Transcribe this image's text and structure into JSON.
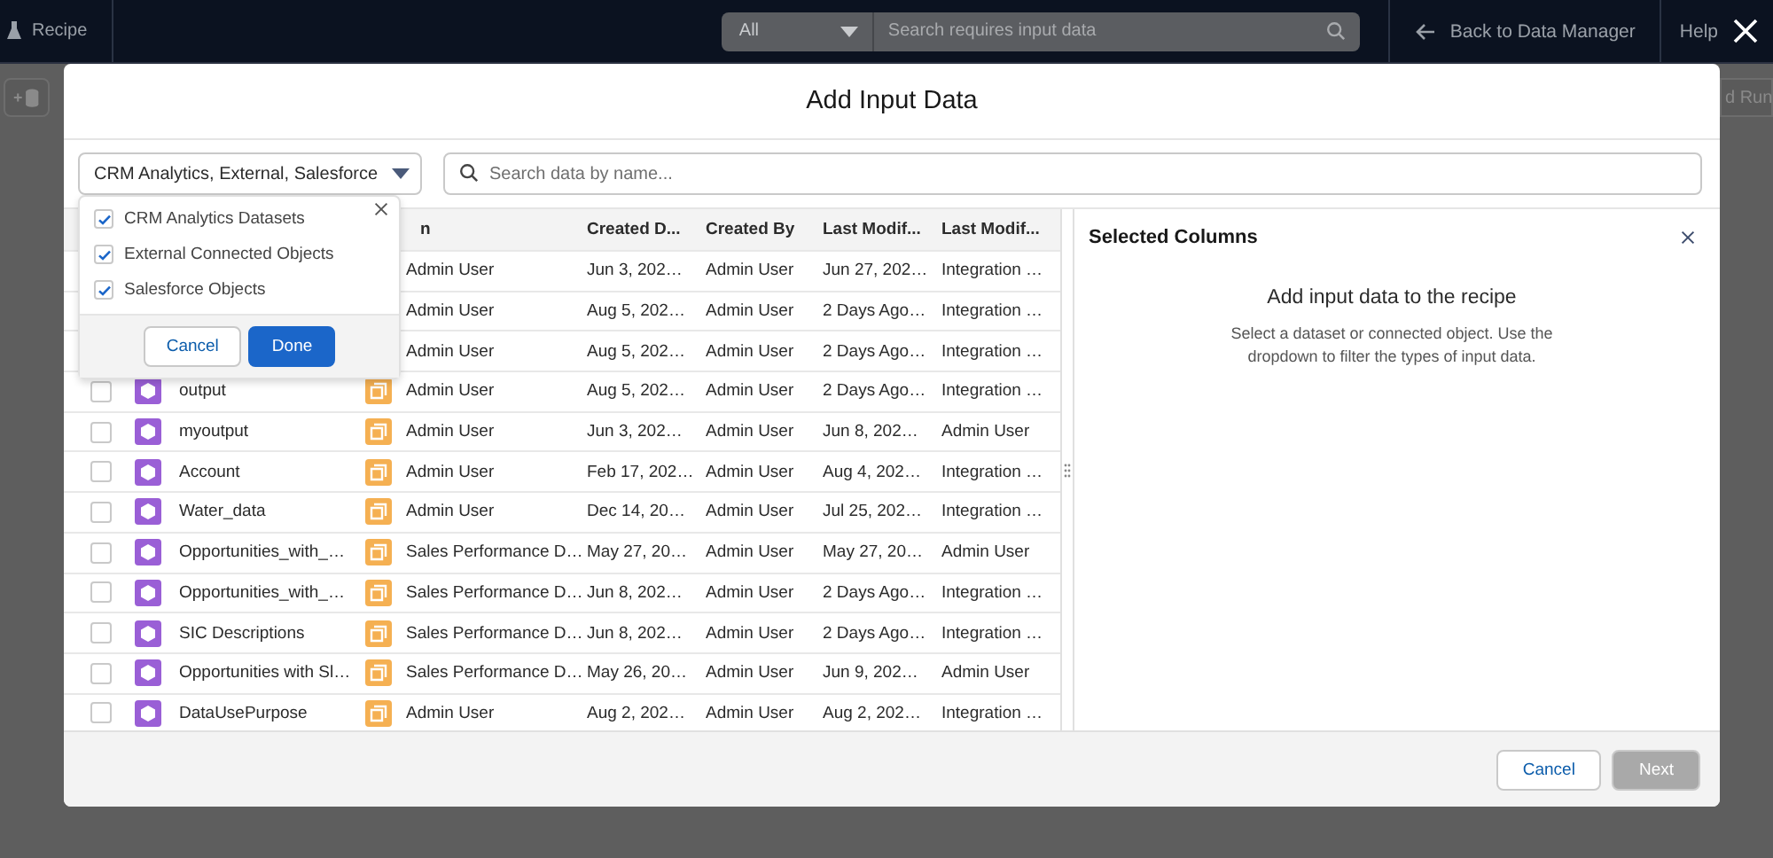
{
  "top_bar": {
    "app_name": "Recipe",
    "search_scope": "All",
    "search_placeholder": "Search requires input data",
    "back_link": "Back to Data Manager",
    "help": "Help"
  },
  "toolbar_right_button": "d Run",
  "dialog": {
    "title": "Add Input Data",
    "filter_dropdown": {
      "value": "CRM Analytics, External, Salesforce",
      "expanded": true,
      "options": [
        {
          "label": "CRM Analytics Datasets",
          "checked": true
        },
        {
          "label": "External Connected Objects",
          "checked": true
        },
        {
          "label": "Salesforce Objects",
          "checked": true
        }
      ],
      "buttons": [
        {
          "label": "Cancel",
          "kind": "neutral"
        },
        {
          "label": "Done",
          "kind": "brand"
        }
      ]
    },
    "search": {
      "placeholder": "Search data by name..."
    },
    "table": {
      "columns": [
        "n",
        "Created D...",
        "Created By",
        "Last Modif...",
        "Last Modif..."
      ],
      "rows": [
        {
          "cells": [
            "Admin User",
            "Jun 3, 202…",
            "Admin User",
            "Jun 27, 202…",
            "Integration …"
          ]
        },
        {
          "cells": [
            "Admin User",
            "Aug 5, 202…",
            "Admin User",
            "2 Days Ago…",
            "Integration …"
          ]
        },
        {
          "cells": [
            "Admin User",
            "Aug 5, 202…",
            "Admin User",
            "2 Days Ago…",
            "Integration …"
          ]
        },
        {
          "name": "output",
          "checked": false,
          "cells": [
            "Admin User",
            "Aug 5, 202…",
            "Admin User",
            "2 Days Ago…",
            "Integration …"
          ]
        },
        {
          "name": "myoutput",
          "checked": false,
          "cells": [
            "Admin User",
            "Jun 3, 202…",
            "Admin User",
            "Jun 8, 202…",
            "Admin User"
          ]
        },
        {
          "name": "Account",
          "checked": false,
          "cells": [
            "Admin User",
            "Feb 17, 202…",
            "Admin User",
            "Aug 4, 202…",
            "Integration …"
          ]
        },
        {
          "name": "Water_data",
          "checked": false,
          "cells": [
            "Admin User",
            "Dec 14, 20…",
            "Admin User",
            "Jul 25, 202…",
            "Integration …"
          ]
        },
        {
          "name": "Opportunities_with_…",
          "checked": false,
          "cells": [
            "Sales Performance D…",
            "May 27, 20…",
            "Admin User",
            "May 27, 20…",
            "Admin User"
          ]
        },
        {
          "name": "Opportunities_with_…",
          "checked": false,
          "cells": [
            "Sales Performance D…",
            "Jun 8, 202…",
            "Admin User",
            "2 Days Ago…",
            "Integration …"
          ]
        },
        {
          "name": "SIC Descriptions",
          "checked": false,
          "cells": [
            "Sales Performance D…",
            "Jun 8, 202…",
            "Admin User",
            "2 Days Ago…",
            "Integration …"
          ]
        },
        {
          "name": "Opportunities with Sl…",
          "checked": false,
          "cells": [
            "Sales Performance D…",
            "May 26, 20…",
            "Admin User",
            "Jun 9, 202…",
            "Admin User"
          ]
        },
        {
          "name": "DataUsePurpose",
          "checked": false,
          "cells": [
            "Admin User",
            "Aug 2, 202…",
            "Admin User",
            "Aug 2, 202…",
            "Integration …"
          ]
        }
      ]
    },
    "selected_columns": {
      "title": "Selected Columns",
      "empty_title": "Add input data to the recipe",
      "empty_text": "Select a dataset or connected object. Use the dropdown to filter the types of input data."
    },
    "footer_buttons": [
      {
        "label": "Cancel",
        "disabled": false
      },
      {
        "label": "Next",
        "disabled": true
      }
    ]
  }
}
